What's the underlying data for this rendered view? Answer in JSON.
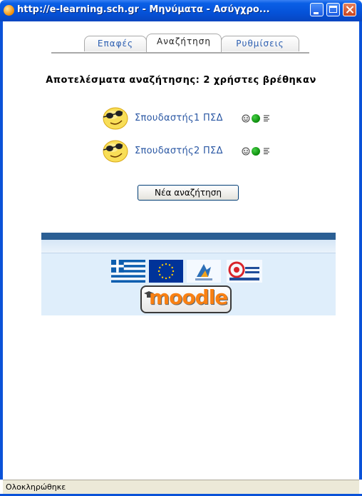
{
  "window": {
    "title": "http://e-learning.sch.gr - Μηνύματα - Ασύγχρο..."
  },
  "tabs": [
    {
      "label": "Επαφές",
      "active": false
    },
    {
      "label": "Αναζήτηση",
      "active": true
    },
    {
      "label": "Ρυθμίσεις",
      "active": false
    }
  ],
  "results": {
    "heading": "Αποτελέσματα αναζήτησης: 2 χρήστες βρέθηκαν",
    "users": [
      {
        "name": "Σπουδαστής1 ΠΣΔ",
        "status_color": "#1a9e1a"
      },
      {
        "name": "Σπουδαστής2 ΠΣΔ",
        "status_color": "#1a9e1a"
      }
    ],
    "new_search_label": "Νέα αναζήτηση"
  },
  "footer": {
    "moodle_label": "moodle"
  },
  "statusbar": {
    "text": "Ολοκληρώθηκε"
  },
  "colors": {
    "titlebar": "#0a5fe6",
    "link": "#2b58a4",
    "footer_bar": "#2b5f94",
    "footer_bg": "#dfeefb"
  }
}
